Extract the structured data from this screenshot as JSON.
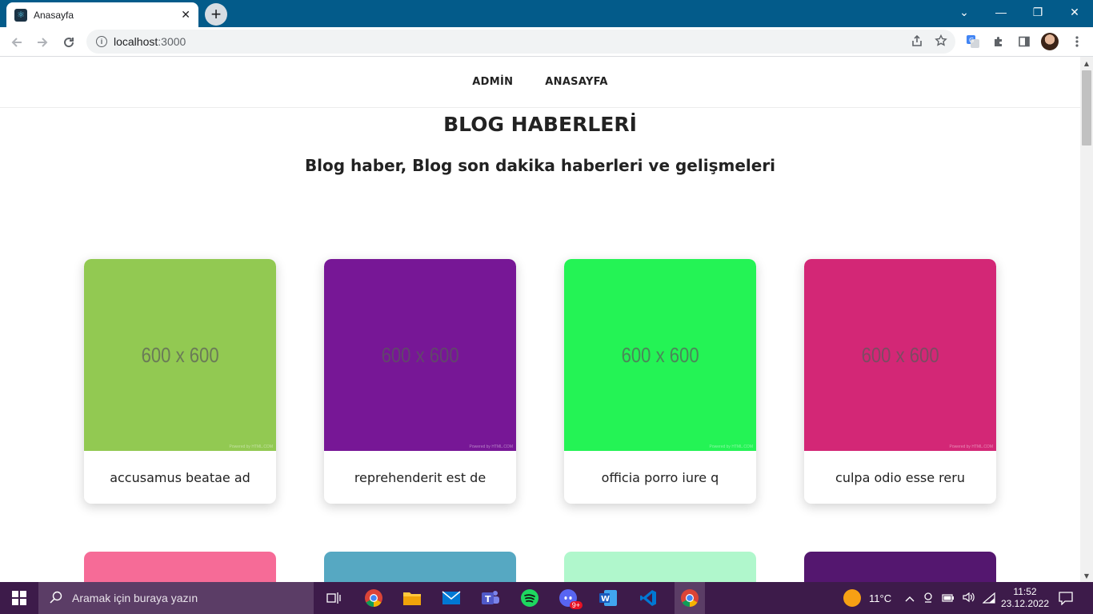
{
  "browser": {
    "tab_title": "Anasayfa",
    "tab_close": "✕",
    "new_tab": "+",
    "url_host": "localhost",
    "url_port": ":3000",
    "window_controls": {
      "tabs_menu": "⌄",
      "minimize": "—",
      "restore": "❐",
      "close": "✕"
    }
  },
  "site": {
    "nav": [
      {
        "label": "ADMİN"
      },
      {
        "label": "ANASAYFA"
      }
    ],
    "heading": "BLOG HABERLERİ",
    "subheading": "Blog haber, Blog son dakika haberleri ve gelişmeleri",
    "cards": [
      {
        "title": "accusamus beatae ad",
        "placeholder": "600 x 600",
        "color": "#92c952",
        "powered": "Powered by HTML.COM"
      },
      {
        "title": "reprehenderit est de",
        "placeholder": "600 x 600",
        "color": "#771796",
        "powered": "Powered by HTML.COM"
      },
      {
        "title": "officia porro iure q",
        "placeholder": "600 x 600",
        "color": "#24f355",
        "powered": "Powered by HTML.COM"
      },
      {
        "title": "culpa odio esse reru",
        "placeholder": "600 x 600",
        "color": "#d32776",
        "powered": "Powered by HTML.COM"
      }
    ],
    "cards_row2_colors": [
      "#f66b97",
      "#56a8c2",
      "#b0f7cc",
      "#54176f"
    ]
  },
  "taskbar": {
    "search_placeholder": "Aramak için buraya yazın",
    "temperature": "11°C",
    "time": "11:52",
    "date": "23.12.2022",
    "discord_badge": "9+"
  }
}
